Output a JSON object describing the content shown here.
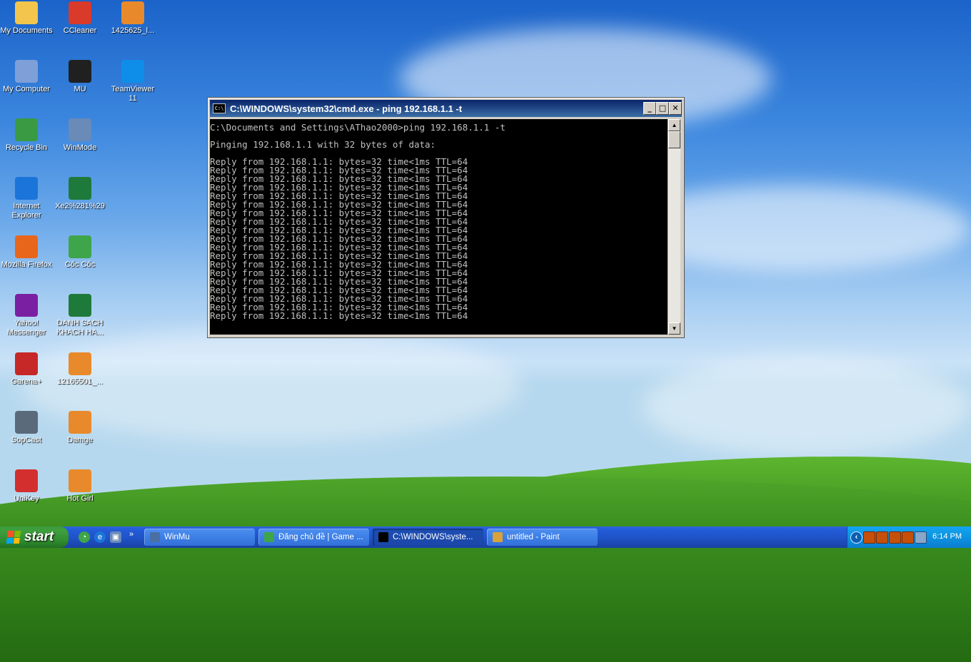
{
  "desktop": {
    "icons": [
      {
        "label": "My Documents",
        "icon": "my-documents-icon",
        "color": "#f3c54c"
      },
      {
        "label": "CCleaner",
        "icon": "ccleaner-icon",
        "color": "#d93a2a"
      },
      {
        "label": "1425625_l...",
        "icon": "image-file-icon",
        "color": "#e88a2b"
      },
      {
        "label": "My Computer",
        "icon": "my-computer-icon",
        "color": "#7f9fd8"
      },
      {
        "label": "MU",
        "icon": "mu-game-icon",
        "color": "#202020"
      },
      {
        "label": "TeamViewer 11",
        "icon": "teamviewer-icon",
        "color": "#0e8ee9"
      },
      {
        "label": "Recycle Bin",
        "icon": "recycle-bin-icon",
        "color": "#3a9a44"
      },
      {
        "label": "WinMode",
        "icon": "winmode-icon",
        "color": "#6a8ab8"
      },
      {
        "label": "Internet Explorer",
        "icon": "internet-explorer-icon",
        "color": "#1b74d9"
      },
      {
        "label": "Xe2%281%29",
        "icon": "excel-file-icon",
        "color": "#1e7a3a"
      },
      {
        "label": "Mozilla Firefox",
        "icon": "firefox-icon",
        "color": "#e8661b"
      },
      {
        "label": "Cốc Cốc",
        "icon": "coccoc-icon",
        "color": "#3fa54a"
      },
      {
        "label": "Yahoo! Messenger",
        "icon": "yahoo-messenger-icon",
        "color": "#7b1fa2"
      },
      {
        "label": "DANH SACH KHACH HA...",
        "icon": "excel-file-icon",
        "color": "#1e7a3a"
      },
      {
        "label": "Garena+",
        "icon": "garena-icon",
        "color": "#c62828"
      },
      {
        "label": "12165501_...",
        "icon": "image-file-icon",
        "color": "#e88a2b"
      },
      {
        "label": "SopCast",
        "icon": "sopcast-icon",
        "color": "#5a6a7a"
      },
      {
        "label": "Damge",
        "icon": "image-file-icon",
        "color": "#e88a2b"
      },
      {
        "label": "UniKey",
        "icon": "unikey-icon",
        "color": "#d32f2f"
      },
      {
        "label": "Hot Girl",
        "icon": "image-file-icon",
        "color": "#e88a2b"
      }
    ]
  },
  "cmd_window": {
    "title": "C:\\WINDOWS\\system32\\cmd.exe - ping 192.168.1.1 -t",
    "minimize": "_",
    "maximize": "□",
    "close": "✕",
    "command_line": "C:\\Documents and Settings\\AThao2000>ping 192.168.1.1 -t",
    "pinging_line": "Pinging 192.168.1.1 with 32 bytes of data:",
    "reply_lines": [
      "Reply from 192.168.1.1: bytes=32 time<1ms TTL=64",
      "Reply from 192.168.1.1: bytes=32 time<1ms TTL=64",
      "Reply from 192.168.1.1: bytes=32 time<1ms TTL=64",
      "Reply from 192.168.1.1: bytes=32 time<1ms TTL=64",
      "Reply from 192.168.1.1: bytes=32 time<1ms TTL=64",
      "Reply from 192.168.1.1: bytes=32 time<1ms TTL=64",
      "Reply from 192.168.1.1: bytes=32 time<1ms TTL=64",
      "Reply from 192.168.1.1: bytes=32 time<1ms TTL=64",
      "Reply from 192.168.1.1: bytes=32 time<1ms TTL=64",
      "Reply from 192.168.1.1: bytes=32 time<1ms TTL=64",
      "Reply from 192.168.1.1: bytes=32 time<1ms TTL=64",
      "Reply from 192.168.1.1: bytes=32 time<1ms TTL=64",
      "Reply from 192.168.1.1: bytes=32 time<1ms TTL=64",
      "Reply from 192.168.1.1: bytes=32 time<1ms TTL=64",
      "Reply from 192.168.1.1: bytes=32 time<1ms TTL=64",
      "Reply from 192.168.1.1: bytes=32 time<1ms TTL=64",
      "Reply from 192.168.1.1: bytes=32 time<1ms TTL=64",
      "Reply from 192.168.1.1: bytes=32 time<1ms TTL=64",
      "Reply from 192.168.1.1: bytes=32 time<1ms TTL=64"
    ]
  },
  "taskbar": {
    "start_label": "start",
    "tasks": [
      {
        "label": "WinMu",
        "icon": "winmu-icon",
        "active": false
      },
      {
        "label": "Đăng chủ đề | Game ...",
        "icon": "coccoc-icon",
        "active": false
      },
      {
        "label": "C:\\WINDOWS\\syste...",
        "icon": "cmd-icon",
        "active": true
      },
      {
        "label": "untitled - Paint",
        "icon": "paint-icon",
        "active": false
      }
    ],
    "quick_launch_more": "»",
    "tray_expand": "‹",
    "clock": "6:14 PM"
  }
}
